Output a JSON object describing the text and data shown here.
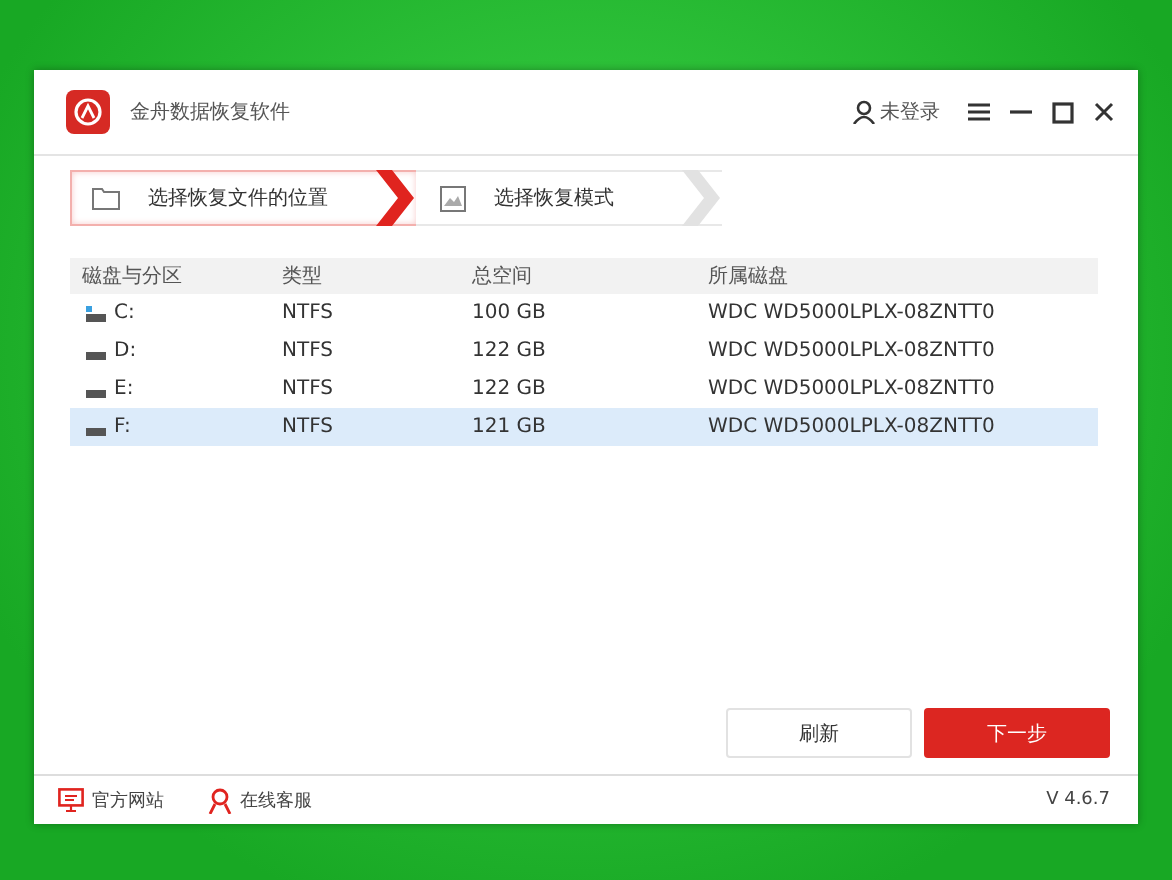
{
  "window": {
    "title": "金舟数据恢复软件",
    "user": "未登录"
  },
  "steps": [
    {
      "label": "选择恢复文件的位置",
      "selected": true,
      "kind": "folder"
    },
    {
      "label": "选择恢复模式",
      "selected": false,
      "kind": "image"
    }
  ],
  "table": {
    "columns": [
      "磁盘与分区",
      "类型",
      "总空间",
      "所属磁盘"
    ],
    "rows": [
      {
        "kind": "system",
        "cells": [
          "C:",
          "NTFS",
          "100 GB",
          "WDC WD5000LPLX-08ZNTT0"
        ],
        "selected": false
      },
      {
        "kind": "disk",
        "cells": [
          "D:",
          "NTFS",
          "122 GB",
          "WDC WD5000LPLX-08ZNTT0"
        ],
        "selected": false
      },
      {
        "kind": "disk",
        "cells": [
          "E:",
          "NTFS",
          "122 GB",
          "WDC WD5000LPLX-08ZNTT0"
        ],
        "selected": false
      },
      {
        "kind": "disk",
        "cells": [
          "F:",
          "NTFS",
          "121 GB",
          "WDC WD5000LPLX-08ZNTT0"
        ],
        "selected": true
      }
    ]
  },
  "buttons": {
    "refresh": "刷新",
    "next": "下一步"
  },
  "footer": {
    "website": "官方网站",
    "service": "在线客服",
    "version": "V 4.6.7"
  }
}
